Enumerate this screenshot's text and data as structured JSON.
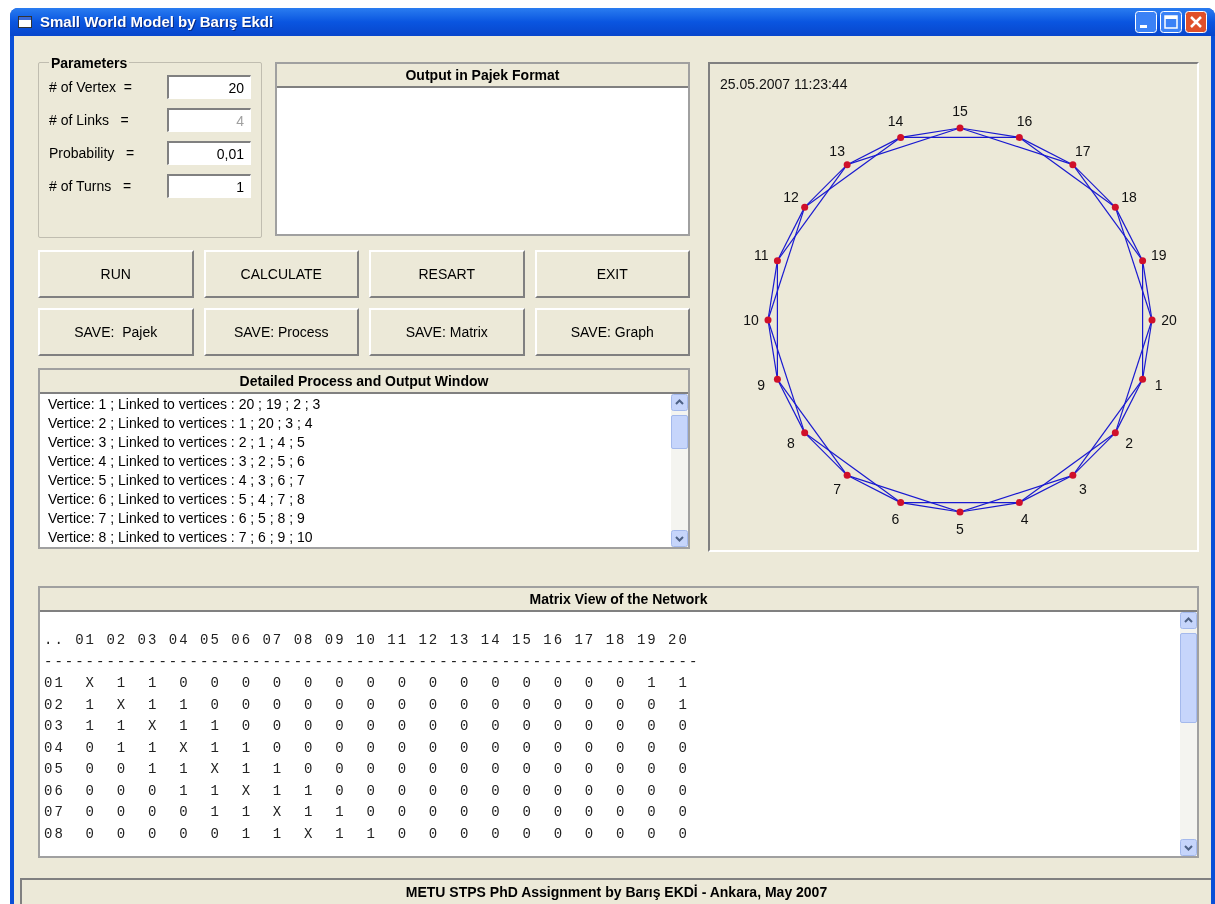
{
  "window": {
    "title": "Small World Model by Barış Ekdi"
  },
  "parameters": {
    "title": "Parameters",
    "fields": [
      {
        "label": "# of Vertex  =",
        "value": "20",
        "disabled": false
      },
      {
        "label": "# of Links   =",
        "value": "4",
        "disabled": true
      },
      {
        "label": "Probability   =",
        "value": "0,01",
        "disabled": false
      },
      {
        "label": "# of Turns   =",
        "value": "1",
        "disabled": false
      }
    ]
  },
  "pajek_output": {
    "title": "Output in Pajek Format"
  },
  "buttons": [
    "RUN",
    "CALCULATE",
    "RESART",
    "EXIT",
    "SAVE:  Pajek",
    "SAVE: Process",
    "SAVE: Matrix",
    "SAVE: Graph"
  ],
  "process_window": {
    "title": "Detailed Process and Output Window",
    "lines": [
      "Vertice: 1 ; Linked to vertices : 20 ; 19 ; 2 ; 3",
      "Vertice: 2 ; Linked to vertices : 1 ; 20 ; 3 ; 4",
      "Vertice: 3 ; Linked to vertices : 2 ; 1 ; 4 ; 5",
      "Vertice: 4 ; Linked to vertices : 3 ; 2 ; 5 ; 6",
      "Vertice: 5 ; Linked to vertices : 4 ; 3 ; 6 ; 7",
      "Vertice: 6 ; Linked to vertices : 5 ; 4 ; 7 ; 8",
      "Vertice: 7 ; Linked to vertices : 6 ; 5 ; 8 ; 9",
      "Vertice: 8 ; Linked to vertices : 7 ; 6 ; 9 ; 10"
    ]
  },
  "network": {
    "timestamp": "25.05.2007 11:23:44",
    "nodes": [
      "1",
      "2",
      "3",
      "4",
      "5",
      "6",
      "7",
      "8",
      "9",
      "10",
      "11",
      "12",
      "13",
      "14",
      "15",
      "16",
      "17",
      "18",
      "19",
      "20"
    ]
  },
  "matrix_view": {
    "title": "Matrix View of the Network",
    "lines": [
      ".. 01 02 03 04 05 06 07 08 09 10 11 12 13 14 15 16 17 18 19 20",
      "---------------------------------------------------------------",
      "01  X  1  1  0  0  0  0  0  0  0  0  0  0  0  0  0  0  0  1  1",
      "02  1  X  1  1  0  0  0  0  0  0  0  0  0  0  0  0  0  0  0  1",
      "03  1  1  X  1  1  0  0  0  0  0  0  0  0  0  0  0  0  0  0  0",
      "04  0  1  1  X  1  1  0  0  0  0  0  0  0  0  0  0  0  0  0  0",
      "05  0  0  1  1  X  1  1  0  0  0  0  0  0  0  0  0  0  0  0  0",
      "06  0  0  0  1  1  X  1  1  0  0  0  0  0  0  0  0  0  0  0  0",
      "07  0  0  0  0  1  1  X  1  1  0  0  0  0  0  0  0  0  0  0  0",
      "08  0  0  0  0  0  1  1  X  1  1  0  0  0  0  0  0  0  0  0  0"
    ]
  },
  "status_bar": {
    "text": "METU STPS PhD Assignment by Barış EKDİ - Ankara, May 2007"
  }
}
